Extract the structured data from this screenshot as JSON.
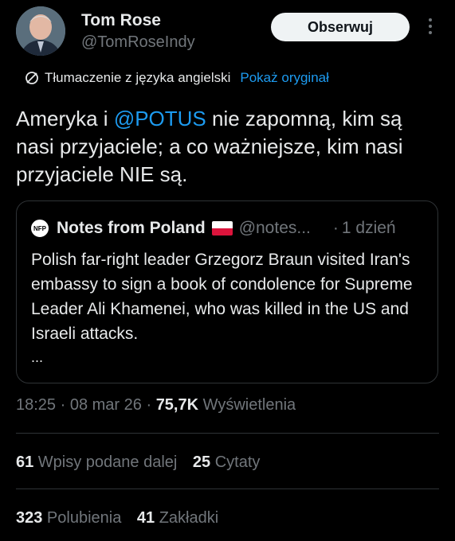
{
  "author": {
    "name": "Tom Rose",
    "handle": "@TomRoseIndy",
    "follow_label": "Obserwuj"
  },
  "translation": {
    "label": "Tłumaczenie z języka angielski",
    "show_original": "Pokaż oryginał"
  },
  "tweet": {
    "text_before": "Ameryka i ",
    "mention": "@POTUS",
    "text_after": " nie zapomną, kim są nasi przyjaciele; a co ważniejsze, kim nasi przyjaciele NIE są."
  },
  "quote": {
    "avatar_text": "NFP",
    "name": "Notes from Poland",
    "handle": "@notes...",
    "dot": "·",
    "time": "1 dzień",
    "text": "Polish far-right leader Grzegorz Braun visited Iran's embassy to sign a book of condolence for Supreme Leader Ali Khamenei, who was killed in the US and Israeli attacks.",
    "ellipsis": "..."
  },
  "meta": {
    "time": "18:25",
    "sep1": " · ",
    "date": "08 mar 26",
    "sep2": " · ",
    "views": "75,7K",
    "views_label": " Wyświetlenia"
  },
  "stats": {
    "reposts": "61",
    "reposts_label": " Wpisy podane dalej",
    "quotes": "25",
    "quotes_label": " Cytaty",
    "likes": "323",
    "likes_label": " Polubienia",
    "bookmarks": "41",
    "bookmarks_label": " Zakładki"
  },
  "colors": {
    "background": "#000000",
    "text": "#e7e9ea",
    "secondary": "#71767b",
    "link": "#1d9bf0",
    "border": "#2f3336"
  }
}
